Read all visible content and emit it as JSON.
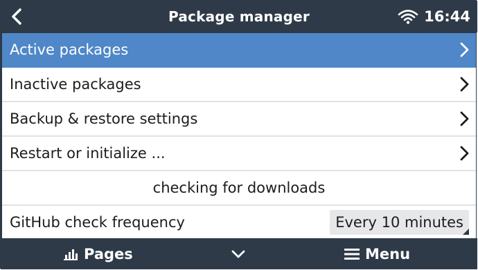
{
  "header": {
    "title": "Package manager",
    "time": "16:44",
    "back_icon": "chevron-left-icon",
    "wifi_icon": "wifi-icon"
  },
  "list": {
    "items": [
      {
        "label": "Active packages",
        "selected": true,
        "icon": "chevron-right-icon"
      },
      {
        "label": "Inactive packages",
        "selected": false,
        "icon": "chevron-right-icon"
      },
      {
        "label": "Backup & restore settings",
        "selected": false,
        "icon": "chevron-right-icon"
      },
      {
        "label": "Restart or initialize ...",
        "selected": false,
        "icon": "chevron-right-icon"
      }
    ],
    "status_text": "checking for downloads",
    "frequency": {
      "label": "GitHub check frequency",
      "value": "Every 10 minutes"
    }
  },
  "footer": {
    "pages_label": "Pages",
    "menu_label": "Menu",
    "pages_icon": "bar-chart-icon",
    "down_icon": "chevron-down-icon",
    "menu_icon": "hamburger-icon"
  },
  "colors": {
    "header_bg": "#2f3a48",
    "selected_row": "#4f87c8",
    "value_bg": "#e6e7e8"
  }
}
